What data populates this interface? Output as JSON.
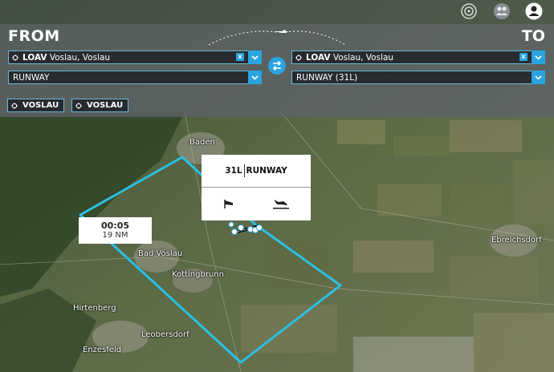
{
  "header": {
    "icons": [
      "target-icon",
      "friends-icon",
      "profile-icon"
    ]
  },
  "from": {
    "label": "FROM",
    "airport_code": "LOAV",
    "airport_name": "Voslau, Voslau",
    "runway": "RUNWAY",
    "tag": "VOSLAU"
  },
  "to": {
    "label": "TO",
    "airport_code": "LOAV",
    "airport_name": "Voslau, Voslau",
    "runway": "RUNWAY (31L)",
    "tag": "VOSLAU"
  },
  "clear_label": "x",
  "route_info": {
    "time": "00:05",
    "distance": "19 NM"
  },
  "runway_popup": {
    "runway_id": "31L",
    "type": "RUNWAY"
  },
  "map_labels": {
    "baden": "Baden",
    "bad_voslau": "Bad Vöslau",
    "kottingbrunn": "Kottingbrunn",
    "hirtenberg": "Hirtenberg",
    "leobersdorf": "Leobersdorf",
    "enzesfeld": "Enzesfeld",
    "ebreichsdorf": "Ebreichsdorf"
  },
  "colors": {
    "accent": "#2aa4e0",
    "route": "#2bc0e4"
  }
}
